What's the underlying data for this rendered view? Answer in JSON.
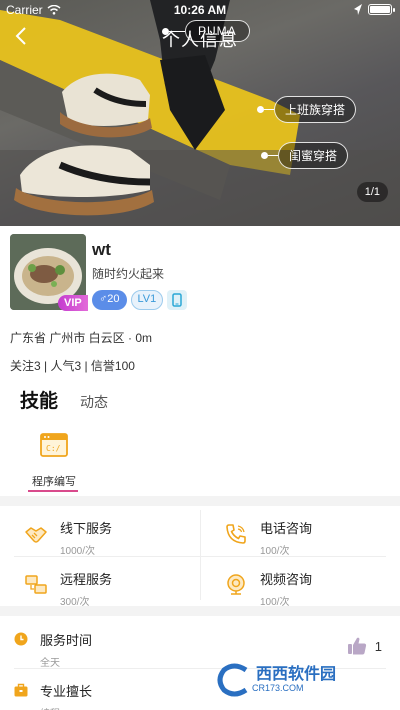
{
  "status_bar": {
    "carrier": "Carrier",
    "time": "10:26 AM"
  },
  "header": {
    "title": "个人信息",
    "back_icon": "back-arrow-icon"
  },
  "hero": {
    "logo_text": "PUMA",
    "tags": [
      "上班族穿搭",
      "闺蜜穿搭"
    ],
    "page_counter": "1/1"
  },
  "profile": {
    "vip_label": "VIP",
    "name": "wt",
    "signature": "随时约火起来",
    "gender_badge": "♂20",
    "level_badge": "LV1",
    "location": "广东省 广州市 白云区 · 0m",
    "stats": "关注3 | 人气3 | 信誉100"
  },
  "tabs": {
    "active": "技能",
    "other": "动态"
  },
  "skills": [
    {
      "label": "程序编写",
      "icon": "code-window-icon"
    }
  ],
  "services": [
    {
      "title": "线下服务",
      "price": "1000/次",
      "icon": "handshake-icon"
    },
    {
      "title": "电话咨询",
      "price": "100/次",
      "icon": "phone-icon"
    },
    {
      "title": "远程服务",
      "price": "300/次",
      "icon": "remote-screens-icon"
    },
    {
      "title": "视频咨询",
      "price": "100/次",
      "icon": "camera-icon"
    }
  ],
  "info": [
    {
      "title": "服务时间",
      "value": "全天",
      "icon": "clock-icon"
    },
    {
      "title": "专业擅长",
      "value": "编程",
      "icon": "briefcase-icon"
    }
  ],
  "likes": "1",
  "watermark": {
    "brand": "西西软件园",
    "site": "CR173.COM"
  },
  "colors": {
    "accent": "#d94a8c",
    "icon_orange": "#f0a51c",
    "gender_blue": "#5b8de8"
  }
}
